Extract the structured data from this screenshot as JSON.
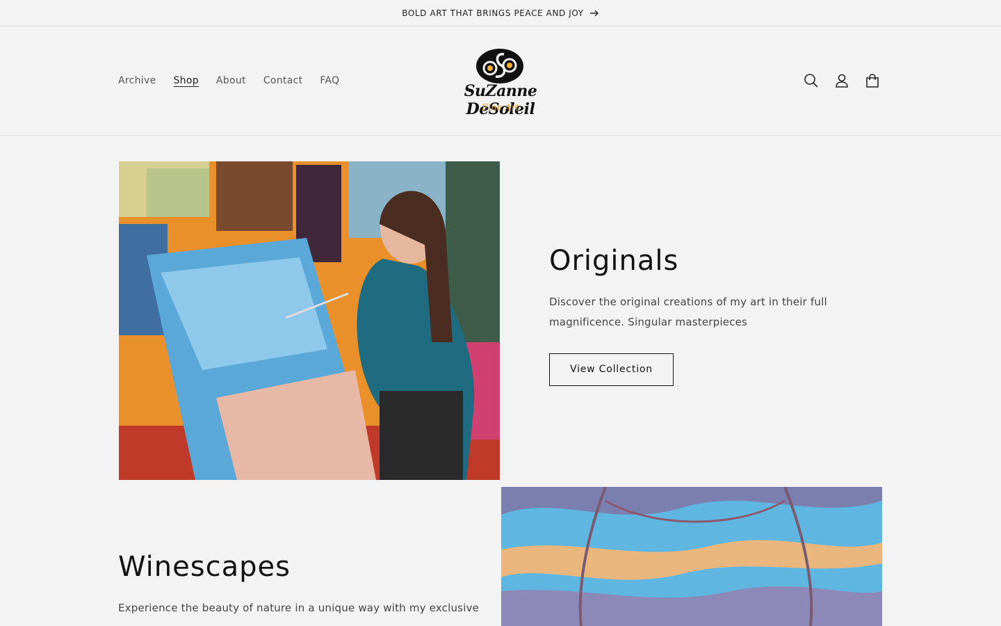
{
  "announcement": {
    "text": "BOLD ART THAT BRINGS PEACE AND JOY"
  },
  "nav": {
    "items": [
      {
        "label": "Archive"
      },
      {
        "label": "Shop",
        "active": true
      },
      {
        "label": "About"
      },
      {
        "label": "Contact"
      },
      {
        "label": "FAQ"
      }
    ]
  },
  "logo": {
    "name": "SuZanne DeSoleil",
    "sub": "Fine Art"
  },
  "header_icons": [
    "search-icon",
    "account-icon",
    "cart-icon"
  ],
  "sections": [
    {
      "title": "Originals",
      "description": "Discover the original creations of my art in their full magnificence. Singular masterpieces",
      "button": "View Collection"
    },
    {
      "title": "Winescapes",
      "description": "Experience the beauty of nature in a unique way with my exclusive"
    }
  ],
  "colors": {
    "background": "#f3f3f3",
    "text": "#121212",
    "logo_accent": "#e5a02a"
  }
}
